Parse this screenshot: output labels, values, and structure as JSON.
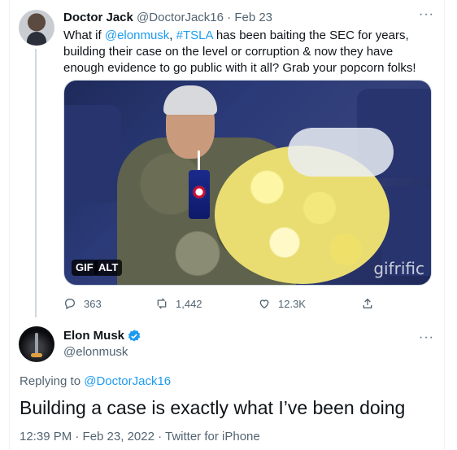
{
  "tweet1": {
    "display_name": "Doctor Jack",
    "handle": "@DoctorJack16",
    "separator": "·",
    "date": "Feb 23",
    "text_parts": [
      "What if ",
      "@elonmusk",
      ", ",
      "#TSLA",
      " has been baiting the SEC for years, building their case on the level or corruption & now they have enough evidence to go public with it all? Grab your popcorn folks!"
    ],
    "media": {
      "gif_badge": "GIF",
      "alt_badge": "ALT",
      "watermark": "gifrific"
    },
    "stats": {
      "replies": "363",
      "retweets": "1,442",
      "likes": "12.3K"
    },
    "icons": [
      "reply-icon",
      "retweet-icon",
      "like-icon",
      "share-icon",
      "more-icon"
    ]
  },
  "tweet2": {
    "display_name": "Elon Musk",
    "handle": "@elonmusk",
    "verified_icon": "verified-badge-icon",
    "replying_prefix": "Replying to ",
    "replying_to": "@DoctorJack16",
    "text": "Building a case is exactly what I’ve been doing",
    "timestamp": "12:39 PM · Feb 23, 2022 · Twitter for iPhone"
  },
  "colors": {
    "accent": "#1d9bf0",
    "text": "#0f1419",
    "muted": "#536471"
  }
}
